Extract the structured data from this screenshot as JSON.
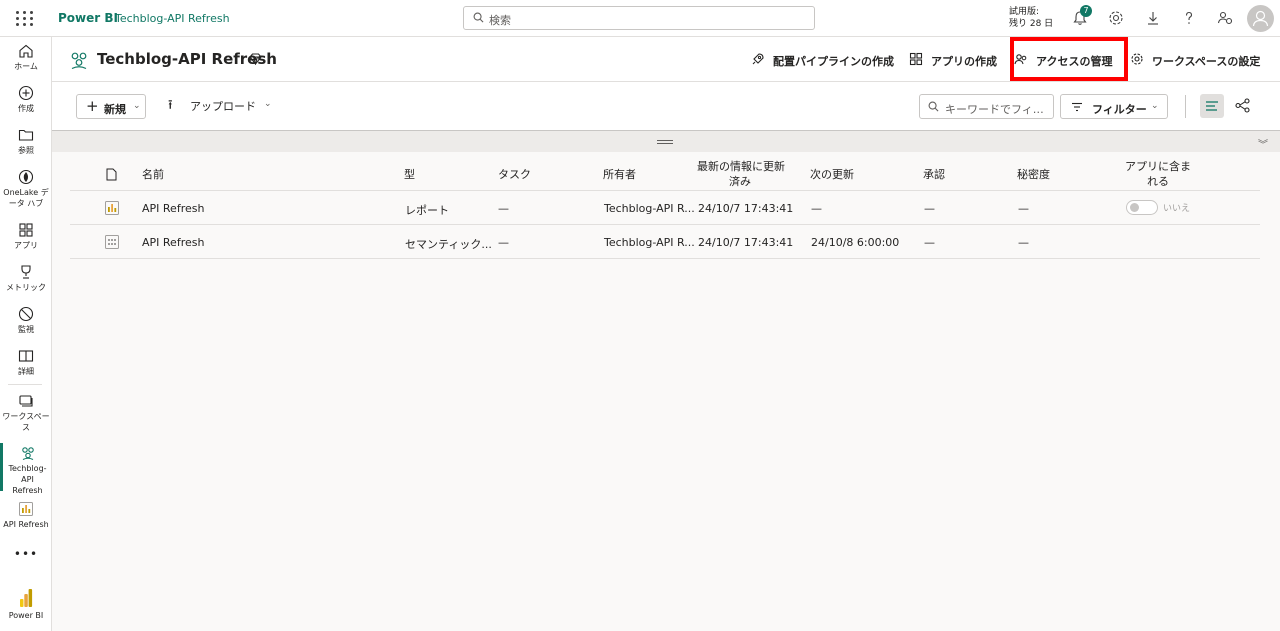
{
  "topbar": {
    "brand": "Power BI",
    "breadcrumb": "Techblog-API Refresh",
    "search_placeholder": "検索",
    "trial_line1": "試用版:",
    "trial_line2": "残り 28 日",
    "notification_count": "7"
  },
  "leftnav": {
    "items": [
      {
        "label": "ホーム",
        "icon": "home-icon"
      },
      {
        "label": "作成",
        "icon": "create-icon"
      },
      {
        "label": "参照",
        "icon": "browse-icon"
      },
      {
        "label": "OneLake データ ハブ",
        "icon": "onelake-icon"
      },
      {
        "label": "アプリ",
        "icon": "apps-icon"
      },
      {
        "label": "メトリック",
        "icon": "metrics-icon"
      },
      {
        "label": "監視",
        "icon": "monitor-icon"
      },
      {
        "label": "詳細",
        "icon": "learn-icon"
      },
      {
        "label": "ワークスペース",
        "icon": "workspaces-icon"
      },
      {
        "label": "Techblog-API Refresh",
        "icon": "workspace-icon"
      },
      {
        "label": "API Refresh",
        "icon": "report-icon"
      }
    ],
    "more": "•••",
    "footer": "Power BI"
  },
  "workspace": {
    "title": "Techblog-API Refresh",
    "actions": {
      "pipeline": "配置パイプラインの作成",
      "create_app": "アプリの作成",
      "manage_access": "アクセスの管理",
      "settings": "ワークスペースの設定"
    }
  },
  "commandbar": {
    "new_label": "新規",
    "upload_label": "アップロード",
    "keyword_placeholder": "キーワードでフィ…",
    "filter_label": "フィルター"
  },
  "table": {
    "headers": {
      "name": "名前",
      "type": "型",
      "task": "タスク",
      "owner": "所有者",
      "refreshed_1": "最新の情報に更新",
      "refreshed_2": "済み",
      "next_refresh": "次の更新",
      "endorsement": "承認",
      "sensitivity": "秘密度",
      "in_app_1": "アプリに含ま",
      "in_app_2": "れる"
    },
    "rows": [
      {
        "name": "API Refresh",
        "type": "レポート",
        "task": "—",
        "owner": "Techblog-API R...",
        "refreshed": "24/10/7 17:43:41",
        "next": "—",
        "endorsement": "—",
        "sensitivity": "—",
        "in_app": "いいえ"
      },
      {
        "name": "API Refresh",
        "type": "セマンティック...",
        "task": "—",
        "owner": "Techblog-API R...",
        "refreshed": "24/10/7 17:43:41",
        "next": "24/10/8 6:00:00",
        "endorsement": "—",
        "sensitivity": "—",
        "in_app": ""
      }
    ]
  },
  "colors": {
    "accent": "#117865",
    "highlight": "#ff0000",
    "powerbi_yellow": "#f2c811"
  }
}
